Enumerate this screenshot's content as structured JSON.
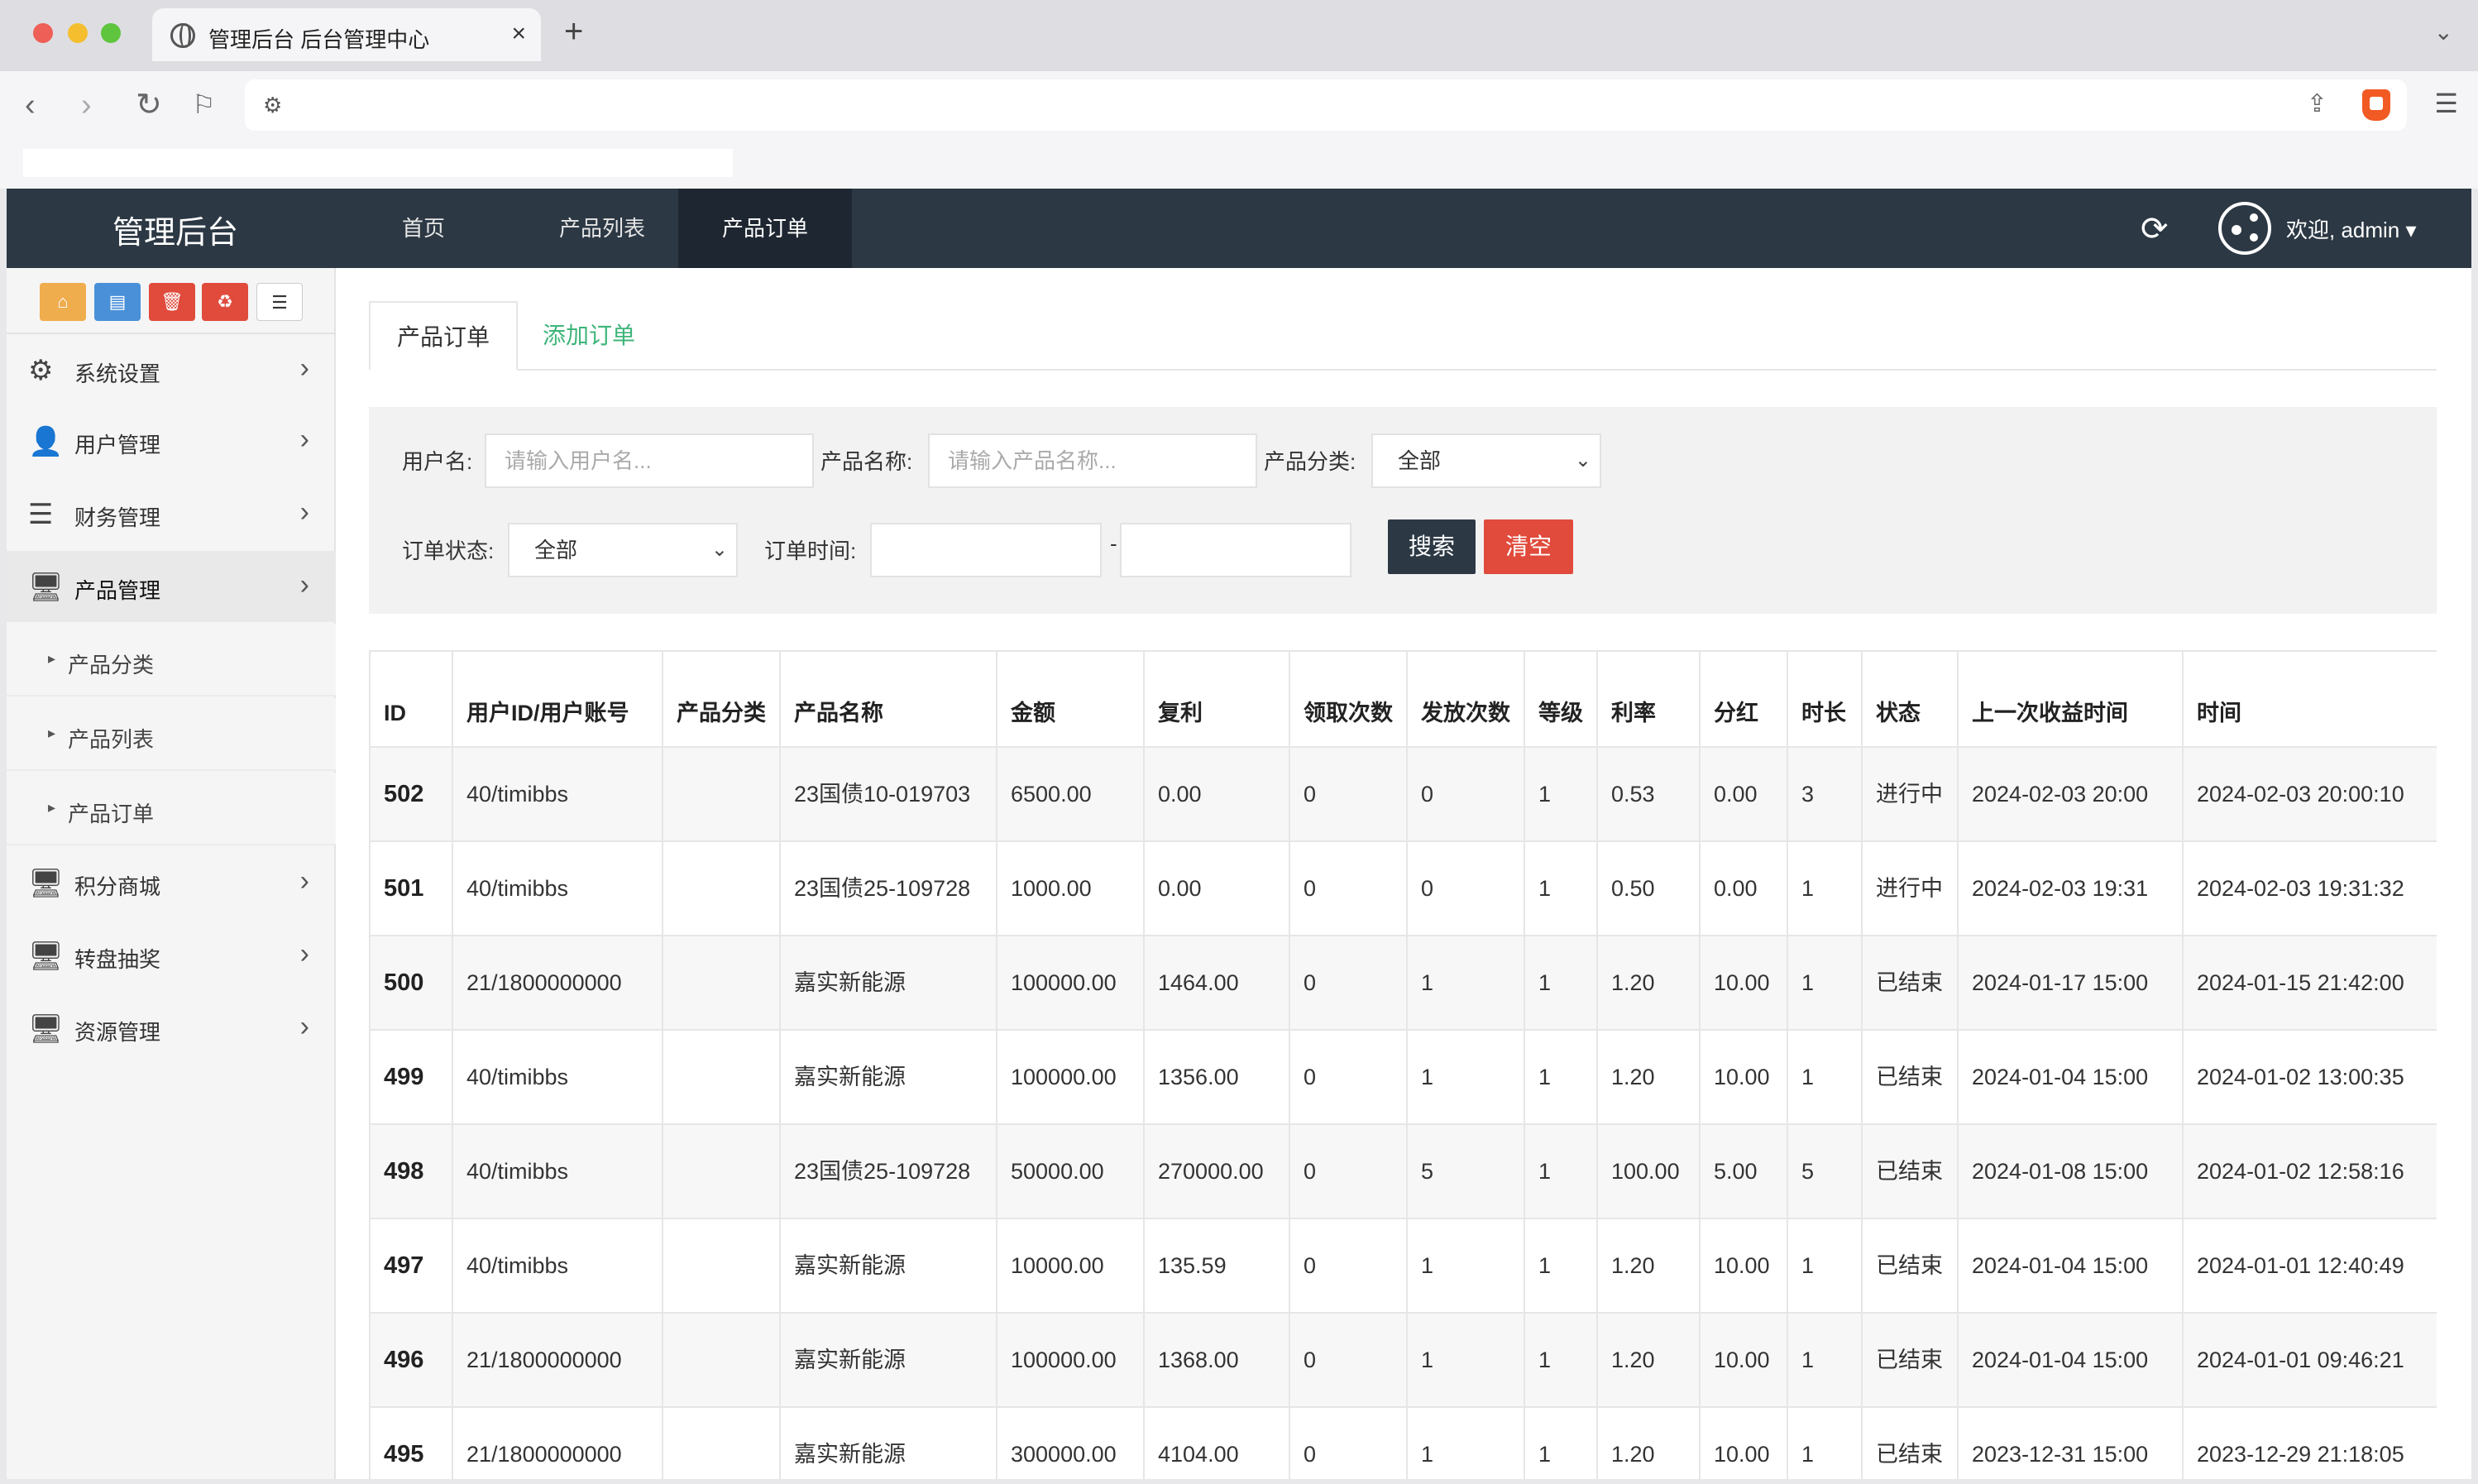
{
  "browser": {
    "tab_title": "管理后台 后台管理中心",
    "tab_close": "×",
    "new_tab": "+"
  },
  "app": {
    "brand": "管理后台",
    "topnav": [
      "首页",
      "产品列表",
      "产品订单"
    ],
    "active_topnav": "产品订单",
    "welcome": "欢迎, admin ▾"
  },
  "sidebar": {
    "quick_buttons": [
      "home-icon",
      "file-icon",
      "trash-icon",
      "recycle-icon",
      "list-icon"
    ],
    "items": [
      {
        "label": "系统设置",
        "icon": "gears-icon"
      },
      {
        "label": "用户管理",
        "icon": "user-icon"
      },
      {
        "label": "财务管理",
        "icon": "database-icon"
      },
      {
        "label": "产品管理",
        "icon": "desktop-icon"
      },
      {
        "label": "积分商城",
        "icon": "desktop-icon"
      },
      {
        "label": "转盘抽奖",
        "icon": "desktop-icon"
      },
      {
        "label": "资源管理",
        "icon": "desktop-icon"
      }
    ],
    "sub_items": [
      "产品分类",
      "产品列表",
      "产品订单"
    ]
  },
  "content": {
    "tabs": [
      "产品订单",
      "添加订单"
    ],
    "filter": {
      "username_label": "用户名:",
      "username_placeholder": "请输入用户名...",
      "product_label": "产品名称:",
      "product_placeholder": "请输入产品名称...",
      "category_label": "产品分类:",
      "category_value": "全部",
      "status_label": "订单状态:",
      "status_value": "全部",
      "time_label": "订单时间:",
      "dash": "-",
      "search_button": "搜索",
      "clear_button": "清空"
    },
    "table": {
      "headers": [
        "ID",
        "用户ID/用户账号",
        "产品分类",
        "产品名称",
        "金额",
        "复利",
        "领取次数",
        "发放次数",
        "等级",
        "利率",
        "分红",
        "时长",
        "状态",
        "上一次收益时间",
        "时间"
      ],
      "rows": [
        [
          "502",
          "40/timibbs",
          "",
          "23国债10-019703",
          "6500.00",
          "0.00",
          "0",
          "0",
          "1",
          "0.53",
          "0.00",
          "3",
          "进行中",
          "2024-02-03 20:00",
          "2024-02-03 20:00:10"
        ],
        [
          "501",
          "40/timibbs",
          "",
          "23国债25-109728",
          "1000.00",
          "0.00",
          "0",
          "0",
          "1",
          "0.50",
          "0.00",
          "1",
          "进行中",
          "2024-02-03 19:31",
          "2024-02-03 19:31:32"
        ],
        [
          "500",
          "21/1800000000",
          "",
          "嘉实新能源",
          "100000.00",
          "1464.00",
          "0",
          "1",
          "1",
          "1.20",
          "10.00",
          "1",
          "已结束",
          "2024-01-17 15:00",
          "2024-01-15 21:42:00"
        ],
        [
          "499",
          "40/timibbs",
          "",
          "嘉实新能源",
          "100000.00",
          "1356.00",
          "0",
          "1",
          "1",
          "1.20",
          "10.00",
          "1",
          "已结束",
          "2024-01-04 15:00",
          "2024-01-02 13:00:35"
        ],
        [
          "498",
          "40/timibbs",
          "",
          "23国债25-109728",
          "50000.00",
          "270000.00",
          "0",
          "5",
          "1",
          "100.00",
          "5.00",
          "5",
          "已结束",
          "2024-01-08 15:00",
          "2024-01-02 12:58:16"
        ],
        [
          "497",
          "40/timibbs",
          "",
          "嘉实新能源",
          "10000.00",
          "135.59",
          "0",
          "1",
          "1",
          "1.20",
          "10.00",
          "1",
          "已结束",
          "2024-01-04 15:00",
          "2024-01-01 12:40:49"
        ],
        [
          "496",
          "21/1800000000",
          "",
          "嘉实新能源",
          "100000.00",
          "1368.00",
          "0",
          "1",
          "1",
          "1.20",
          "10.00",
          "1",
          "已结束",
          "2024-01-04 15:00",
          "2024-01-01 09:46:21"
        ],
        [
          "495",
          "21/1800000000",
          "",
          "嘉实新能源",
          "300000.00",
          "4104.00",
          "0",
          "1",
          "1",
          "1.20",
          "10.00",
          "1",
          "已结束",
          "2023-12-31 15:00",
          "2023-12-29 21:18:05"
        ]
      ]
    }
  }
}
